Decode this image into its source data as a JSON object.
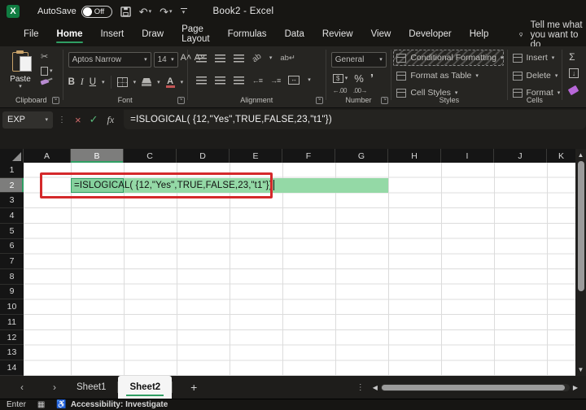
{
  "colors": {
    "tab-underline": "#2F9E63",
    "band-green": "#94D9A6",
    "cell-green": "#85D19D",
    "cell-border-green": "#2F9E63",
    "annotation-red": "#D4292B",
    "accent": "#107C41"
  },
  "titlebar": {
    "logo_letter": "X",
    "autosave_label": "AutoSave",
    "autosave_state": "Off",
    "doc_title": "Book2  -  Excel"
  },
  "ribbon_tabs": {
    "items": [
      {
        "label": "File"
      },
      {
        "label": "Home"
      },
      {
        "label": "Insert"
      },
      {
        "label": "Draw"
      },
      {
        "label": "Page Layout"
      },
      {
        "label": "Formulas"
      },
      {
        "label": "Data"
      },
      {
        "label": "Review"
      },
      {
        "label": "View"
      },
      {
        "label": "Developer"
      },
      {
        "label": "Help"
      }
    ],
    "tell_me": "Tell me what you want to do"
  },
  "ribbon": {
    "clipboard": {
      "group_label": "Clipboard",
      "paste_label": "Paste"
    },
    "font": {
      "group_label": "Font",
      "font_name": "Aptos Narrow",
      "font_size": "14",
      "bold": "B",
      "italic": "I",
      "underline": "U",
      "grow_font": "A˄",
      "shrink_font": "A˅",
      "font_color_letter": "A"
    },
    "alignment": {
      "group_label": "Alignment",
      "orientation_glyph": "ab",
      "wrap_glyph": "ab↵",
      "indent_left": "←≡",
      "indent_right": "→≡"
    },
    "number": {
      "group_label": "Number",
      "format": "General",
      "accounting_glyph": "$",
      "percent": "%",
      "comma": "’",
      "increase_decimal": "←.00",
      "decrease_decimal": ".00→"
    },
    "styles": {
      "group_label": "Styles",
      "items": [
        {
          "label": "Conditional Formatting"
        },
        {
          "label": "Format as Table"
        },
        {
          "label": "Cell Styles"
        }
      ]
    },
    "cells": {
      "group_label": "Cells",
      "items": [
        {
          "label": "Insert"
        },
        {
          "label": "Delete"
        },
        {
          "label": "Format"
        }
      ]
    },
    "editing": {
      "autosum_glyph": "Σ",
      "fill_glyph": "↓"
    }
  },
  "formula_bar": {
    "name_box": "EXP",
    "cancel_glyph": "×",
    "confirm_glyph": "✓",
    "fx_glyph": "fx",
    "formula": "=ISLOGICAL( {12,\"Yes\",TRUE,FALSE,23,\"t1\"})"
  },
  "grid": {
    "columns": [
      "A",
      "B",
      "C",
      "D",
      "E",
      "F",
      "G",
      "H",
      "I",
      "J",
      "K"
    ],
    "rows": [
      "1",
      "2",
      "3",
      "4",
      "5",
      "6",
      "7",
      "8",
      "9",
      "10",
      "11",
      "12",
      "13",
      "14"
    ],
    "selected_column": "B",
    "selected_row": "2",
    "active_cell": "B2",
    "cell_text": "=ISLOGICAL( {12,\"Yes\",TRUE,FALSE,23,\"t1\"})",
    "highlight_range": "B2:G2"
  },
  "sheet_tabs": {
    "prev_glyph": "‹",
    "next_glyph": "›",
    "tabs": [
      {
        "label": "Sheet1"
      },
      {
        "label": "Sheet2"
      }
    ],
    "add_label": "+"
  },
  "status_bar": {
    "mode": "Enter",
    "accessibility": "Accessibility: Investigate"
  }
}
